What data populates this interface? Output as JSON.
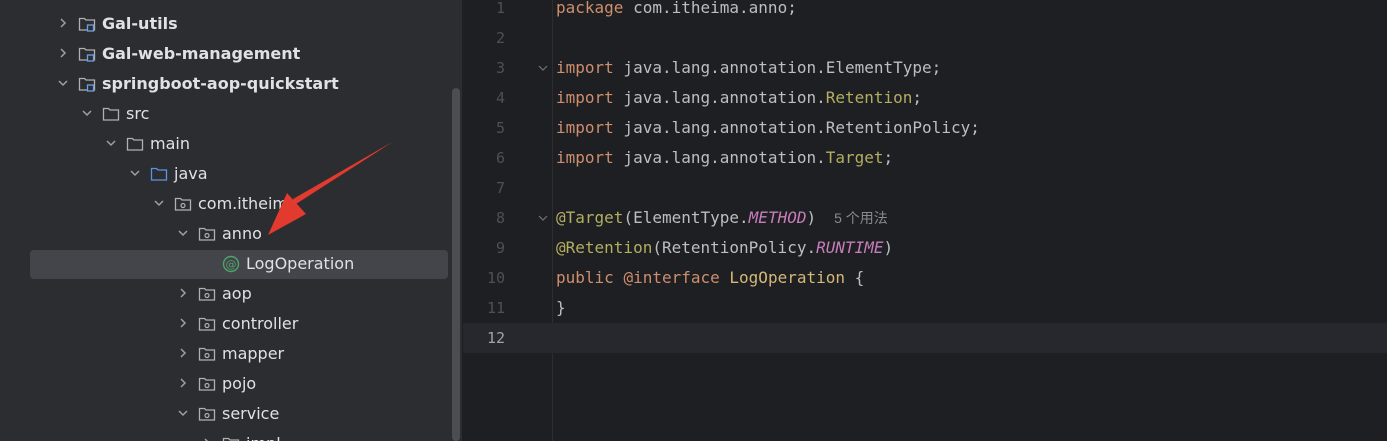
{
  "project_tree": {
    "items": [
      {
        "label": "Gal-utils",
        "type": "module",
        "expanded": false,
        "bold": true
      },
      {
        "label": "Gal-web-management",
        "type": "module",
        "expanded": false,
        "bold": true
      },
      {
        "label": "springboot-aop-quickstart",
        "type": "module",
        "expanded": true,
        "bold": true
      },
      {
        "label": "src",
        "type": "folder",
        "expanded": true,
        "bold": false
      },
      {
        "label": "main",
        "type": "folder",
        "expanded": true,
        "bold": false
      },
      {
        "label": "java",
        "type": "source-folder",
        "expanded": true,
        "bold": false
      },
      {
        "label": "com.itheima",
        "type": "package",
        "expanded": true,
        "bold": false
      },
      {
        "label": "anno",
        "type": "package",
        "expanded": true,
        "bold": false
      },
      {
        "label": "LogOperation",
        "type": "annotation",
        "expanded": null,
        "bold": false,
        "selected": true
      },
      {
        "label": "aop",
        "type": "package",
        "expanded": false,
        "bold": false
      },
      {
        "label": "controller",
        "type": "package",
        "expanded": false,
        "bold": false
      },
      {
        "label": "mapper",
        "type": "package",
        "expanded": false,
        "bold": false
      },
      {
        "label": "pojo",
        "type": "package",
        "expanded": false,
        "bold": false
      },
      {
        "label": "service",
        "type": "package",
        "expanded": true,
        "bold": false
      },
      {
        "label": "impl",
        "type": "package",
        "expanded": false,
        "bold": false
      }
    ]
  },
  "editor": {
    "current_line": 12,
    "line_numbers": [
      "1",
      "2",
      "3",
      "4",
      "5",
      "6",
      "7",
      "8",
      "9",
      "10",
      "11",
      "12"
    ],
    "lines": [
      {
        "tokens": [
          {
            "t": "package",
            "c": "kw"
          },
          {
            "t": " com.itheima.anno;",
            "c": "pl"
          }
        ]
      },
      {
        "tokens": []
      },
      {
        "tokens": [
          {
            "t": "import",
            "c": "kw"
          },
          {
            "t": " java.lang.annotation.ElementType;",
            "c": "pl"
          }
        ],
        "fold": true
      },
      {
        "tokens": [
          {
            "t": "import",
            "c": "kw"
          },
          {
            "t": " java.lang.annotation.",
            "c": "pl"
          },
          {
            "t": "Retention",
            "c": "cls"
          },
          {
            "t": ";",
            "c": "pl"
          }
        ]
      },
      {
        "tokens": [
          {
            "t": "import",
            "c": "kw"
          },
          {
            "t": " java.lang.annotation.RetentionPolicy;",
            "c": "pl"
          }
        ]
      },
      {
        "tokens": [
          {
            "t": "import",
            "c": "kw"
          },
          {
            "t": " java.lang.annotation.",
            "c": "pl"
          },
          {
            "t": "Target",
            "c": "cls"
          },
          {
            "t": ";",
            "c": "pl"
          }
        ]
      },
      {
        "tokens": []
      },
      {
        "tokens": [
          {
            "t": "@Target",
            "c": "ann"
          },
          {
            "t": "(ElementType.",
            "c": "pl"
          },
          {
            "t": "METHOD",
            "c": "const"
          },
          {
            "t": ")",
            "c": "pl"
          },
          {
            "t": "5 个用法",
            "c": "hint"
          }
        ],
        "fold": true
      },
      {
        "tokens": [
          {
            "t": "@Retention",
            "c": "ann"
          },
          {
            "t": "(RetentionPolicy.",
            "c": "pl"
          },
          {
            "t": "RUNTIME",
            "c": "const"
          },
          {
            "t": ")",
            "c": "pl"
          }
        ]
      },
      {
        "tokens": [
          {
            "t": "public",
            "c": "kw"
          },
          {
            "t": " ",
            "c": "pl"
          },
          {
            "t": "@interface",
            "c": "kw"
          },
          {
            "t": " ",
            "c": "pl"
          },
          {
            "t": "LogOperation",
            "c": "decl"
          },
          {
            "t": " {",
            "c": "pl"
          }
        ]
      },
      {
        "tokens": [
          {
            "t": "}",
            "c": "pl"
          }
        ]
      },
      {
        "tokens": []
      }
    ]
  },
  "colors": {
    "tree_bg": "#2b2d30",
    "editor_bg": "#1e1f22",
    "selection": "#43454a",
    "keyword": "#cf8e6d",
    "annotation": "#b3ae60",
    "constant": "#c77dbb",
    "arrow": "#e8322b"
  }
}
